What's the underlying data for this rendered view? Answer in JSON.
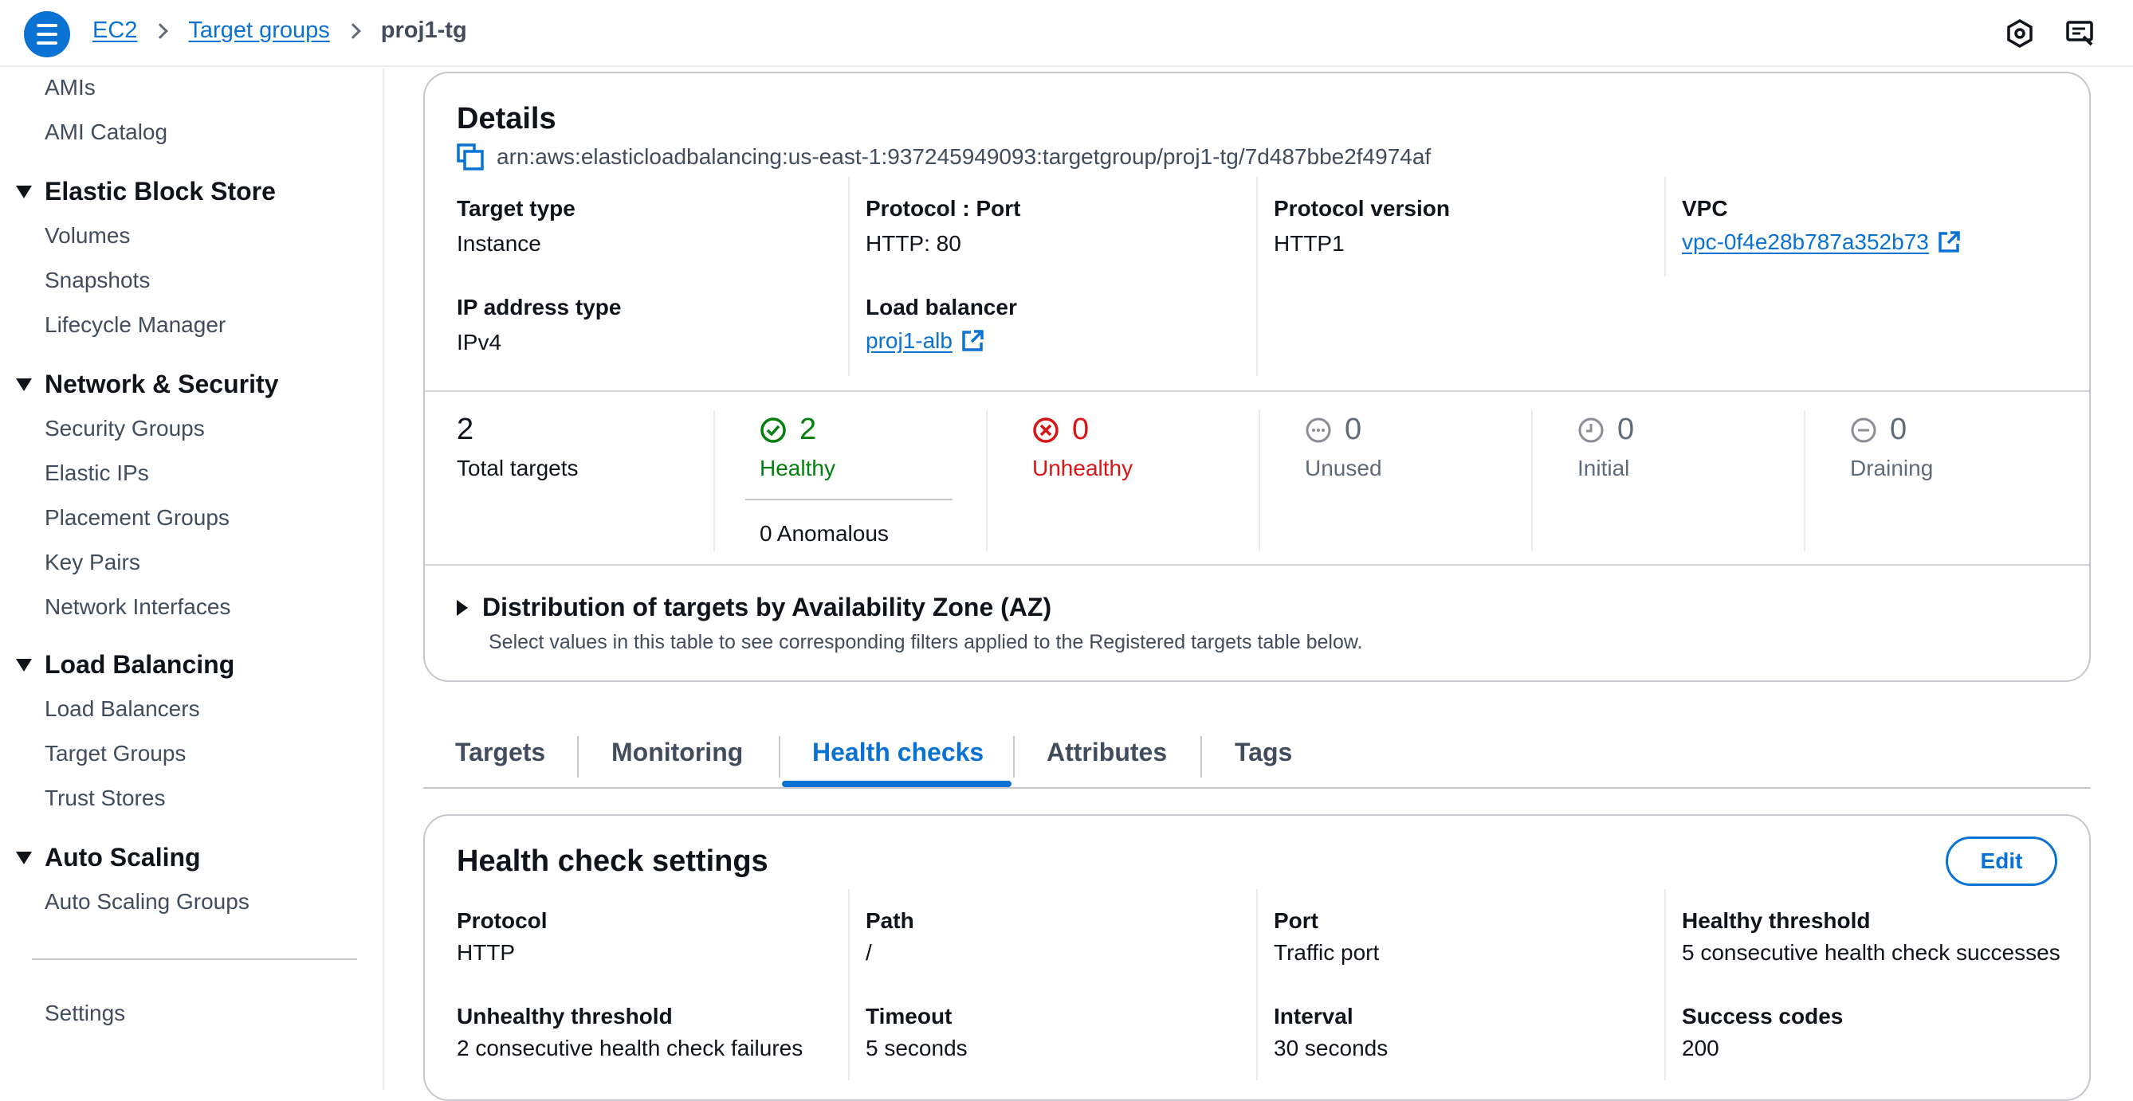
{
  "breadcrumb": {
    "service": "EC2",
    "section": "Target groups",
    "current": "proj1-tg"
  },
  "sidebar": {
    "top_items": [
      "AMIs",
      "AMI Catalog"
    ],
    "sections": [
      {
        "title": "Elastic Block Store",
        "items": [
          "Volumes",
          "Snapshots",
          "Lifecycle Manager"
        ]
      },
      {
        "title": "Network & Security",
        "items": [
          "Security Groups",
          "Elastic IPs",
          "Placement Groups",
          "Key Pairs",
          "Network Interfaces"
        ]
      },
      {
        "title": "Load Balancing",
        "items": [
          "Load Balancers",
          "Target Groups",
          "Trust Stores"
        ]
      },
      {
        "title": "Auto Scaling",
        "items": [
          "Auto Scaling Groups"
        ]
      }
    ],
    "settings": "Settings"
  },
  "details": {
    "title": "Details",
    "arn": "arn:aws:elasticloadbalancing:us-east-1:937245949093:targetgroup/proj1-tg/7d487bbe2f4974af",
    "target_type_label": "Target type",
    "target_type": "Instance",
    "protocol_port_label": "Protocol : Port",
    "protocol_port": "HTTP: 80",
    "protocol_version_label": "Protocol version",
    "protocol_version": "HTTP1",
    "vpc_label": "VPC",
    "vpc": "vpc-0f4e28b787a352b73",
    "ip_type_label": "IP address type",
    "ip_type": "IPv4",
    "lb_label": "Load balancer",
    "lb": "proj1-alb"
  },
  "stats": {
    "total": "2",
    "total_label": "Total targets",
    "healthy": "2",
    "healthy_label": "Healthy",
    "anomalous": "0 Anomalous",
    "unhealthy": "0",
    "unhealthy_label": "Unhealthy",
    "unused": "0",
    "unused_label": "Unused",
    "initial": "0",
    "initial_label": "Initial",
    "draining": "0",
    "draining_label": "Draining"
  },
  "distribution": {
    "title": "Distribution of targets by Availability Zone (AZ)",
    "subtitle": "Select values in this table to see corresponding filters applied to the Registered targets table below."
  },
  "tabs": [
    "Targets",
    "Monitoring",
    "Health checks",
    "Attributes",
    "Tags"
  ],
  "health_check": {
    "title": "Health check settings",
    "edit_label": "Edit",
    "protocol_label": "Protocol",
    "protocol": "HTTP",
    "path_label": "Path",
    "path": "/",
    "port_label": "Port",
    "port": "Traffic port",
    "healthy_threshold_label": "Healthy threshold",
    "healthy_threshold": "5 consecutive health check successes",
    "unhealthy_threshold_label": "Unhealthy threshold",
    "unhealthy_threshold": "2 consecutive health check failures",
    "timeout_label": "Timeout",
    "timeout": "5 seconds",
    "interval_label": "Interval",
    "interval": "30 seconds",
    "success_codes_label": "Success codes",
    "success_codes": "200"
  },
  "colors": {
    "link": "#0972d3",
    "healthy": "#037f0c",
    "unhealthy": "#d91515",
    "muted": "#5f6b7a"
  }
}
